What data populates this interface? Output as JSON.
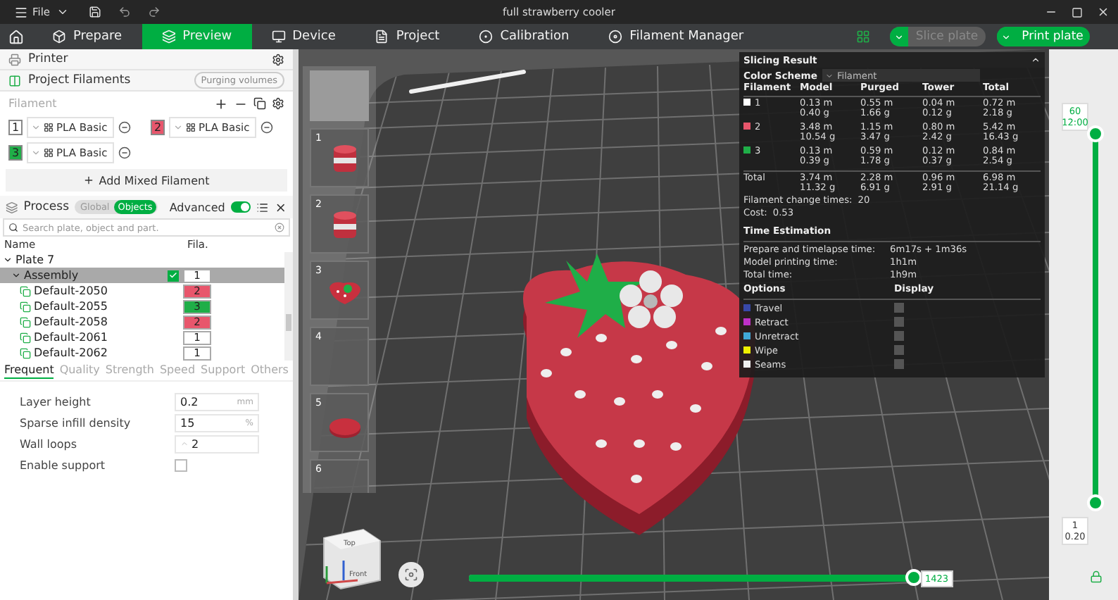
{
  "window": {
    "title": "full strawberry cooler",
    "menu": "File"
  },
  "tabs": [
    {
      "label": "Prepare",
      "selected": false
    },
    {
      "label": "Preview",
      "selected": true
    },
    {
      "label": "Device",
      "selected": false
    },
    {
      "label": "Project",
      "selected": false
    },
    {
      "label": "Calibration",
      "selected": false
    },
    {
      "label": "Filament Manager",
      "selected": false
    }
  ],
  "actions": [
    {
      "label": "Slice plate",
      "disabled": true
    },
    {
      "label": "Print plate",
      "disabled": false
    }
  ],
  "sidebar": {
    "printer_title": "Printer",
    "filaments_title": "Project Filaments",
    "purging_button": "Purging volumes",
    "filament_label": "Filament",
    "filaments": [
      {
        "index": "1",
        "name": "PLA Basic",
        "color": "#ffffff"
      },
      {
        "index": "2",
        "name": "PLA Basic",
        "color": "#e8566c"
      },
      {
        "index": "3",
        "name": "PLA Basic",
        "color": "#1fae48"
      }
    ],
    "add_mixed": "Add Mixed Filament",
    "process": {
      "title": "Process",
      "modes": [
        {
          "label": "Global",
          "selected": false
        },
        {
          "label": "Objects",
          "selected": true
        }
      ],
      "advanced_label": "Advanced",
      "advanced_on": true
    },
    "search_placeholder": "Search plate, object and part.",
    "columns": [
      "Name",
      "Fila."
    ],
    "tree": [
      {
        "name": "Plate 7",
        "expanded": true,
        "selected": false,
        "children": [
          {
            "name": "Assembly",
            "expanded": true,
            "checked": true,
            "filament": "1",
            "selected": true,
            "children": [
              {
                "name": "Default-2050",
                "filament": "2",
                "selected": false
              },
              {
                "name": "Default-2055",
                "filament": "3",
                "selected": false
              },
              {
                "name": "Default-2058",
                "filament": "2",
                "selected": false
              },
              {
                "name": "Default-2061",
                "filament": "1",
                "selected": false
              },
              {
                "name": "Default-2062",
                "filament": "1",
                "selected": false
              }
            ]
          }
        ]
      }
    ],
    "setting_tabs": [
      {
        "label": "Frequent",
        "selected": true
      },
      {
        "label": "Quality",
        "selected": false
      },
      {
        "label": "Strength",
        "selected": false
      },
      {
        "label": "Speed",
        "selected": false
      },
      {
        "label": "Support",
        "selected": false
      },
      {
        "label": "Others",
        "selected": false
      }
    ],
    "settings": [
      {
        "kind": "number",
        "label": "Layer height",
        "value": "0.2",
        "unit": "mm"
      },
      {
        "kind": "number",
        "label": "Sparse infill density",
        "value": "15",
        "unit": "%"
      },
      {
        "kind": "spin",
        "label": "Wall loops",
        "value": "2"
      },
      {
        "kind": "checkbox",
        "label": "Enable support",
        "checked": false
      }
    ]
  },
  "plates": [
    {
      "label": "1",
      "kind": "cup"
    },
    {
      "label": "2",
      "kind": "cup"
    },
    {
      "label": "3",
      "kind": "heart"
    },
    {
      "label": "4",
      "kind": "empty"
    },
    {
      "label": "5",
      "kind": "lid"
    },
    {
      "label": "6",
      "kind": "empty"
    }
  ],
  "slicing_result": {
    "title": "Slicing Result",
    "color_scheme_label": "Color Scheme",
    "color_scheme": "Filament",
    "columns": [
      "Filament",
      "Model",
      "Purged",
      "Tower",
      "Total"
    ],
    "rows": [
      {
        "color": "#ffffff",
        "cells": [
          [
            "1"
          ],
          [
            "0.13 m",
            "0.40 g"
          ],
          [
            "0.55 m",
            "1.66 g"
          ],
          [
            "0.04 m",
            "0.12 g"
          ],
          [
            "0.72 m",
            "2.18 g"
          ]
        ]
      },
      {
        "color": "#e8566c",
        "cells": [
          [
            "2"
          ],
          [
            "3.48 m",
            "10.54 g"
          ],
          [
            "1.15 m",
            "3.47 g"
          ],
          [
            "0.80 m",
            "2.42 g"
          ],
          [
            "5.42 m",
            "16.43 g"
          ]
        ]
      },
      {
        "color": "#1fae48",
        "cells": [
          [
            "3"
          ],
          [
            "0.13 m",
            "0.39 g"
          ],
          [
            "0.59 m",
            "1.78 g"
          ],
          [
            "0.12 m",
            "0.37 g"
          ],
          [
            "0.84 m",
            "2.54 g"
          ]
        ]
      }
    ],
    "total": {
      "cells": [
        [
          "Total"
        ],
        [
          "3.74 m",
          "11.32 g"
        ],
        [
          "2.28 m",
          "6.91 g"
        ],
        [
          "0.96 m",
          "2.91 g"
        ],
        [
          "6.98 m",
          "21.14 g"
        ]
      ]
    },
    "change_times": {
      "label": "Filament change times:",
      "value": "20"
    },
    "cost": {
      "label": "Cost:",
      "value": "0.53"
    },
    "time_title": "Time Estimation",
    "times": [
      {
        "label": "Prepare and timelapse time:",
        "value": "6m17s + 1m36s"
      },
      {
        "label": "Model printing time:",
        "value": "1h1m"
      },
      {
        "label": "Total time:",
        "value": "1h9m"
      }
    ],
    "options_columns": [
      "Options",
      "Display"
    ],
    "options": [
      {
        "label": "Travel",
        "color": "#3848a8",
        "display": false
      },
      {
        "label": "Retract",
        "color": "#c030c8",
        "display": false
      },
      {
        "label": "Unretract",
        "color": "#40a8d8",
        "display": false
      },
      {
        "label": "Wipe",
        "color": "#f0f000",
        "display": false
      },
      {
        "label": "Seams",
        "color": "#f0f0f0",
        "display": false
      }
    ]
  },
  "layer_slider": {
    "upper": {
      "level": 1,
      "labels": [
        "60",
        "12:00"
      ]
    },
    "lower": {
      "level": 0,
      "labels": [
        "1",
        "0.20"
      ]
    }
  },
  "move_slider": {
    "level": 1,
    "label": "1423"
  },
  "view_cube": {
    "top": "Top",
    "front": "Front"
  }
}
